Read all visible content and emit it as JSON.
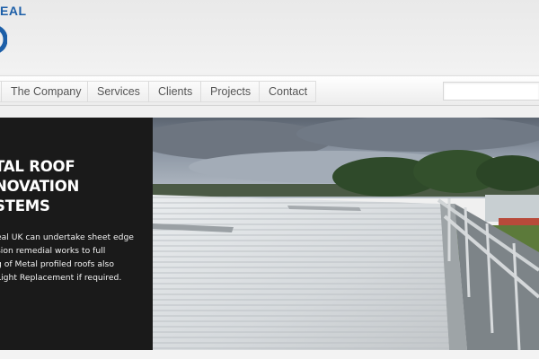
{
  "header": {
    "logo_text": "EAL",
    "logo_icon": "company-logo-mark"
  },
  "nav": {
    "items": [
      {
        "label": "The Company"
      },
      {
        "label": "Services"
      },
      {
        "label": "Clients"
      },
      {
        "label": "Projects"
      },
      {
        "label": "Contact"
      }
    ],
    "search_placeholder": ""
  },
  "hero": {
    "heading": "TAL ROOF\nNOVATION\nSTEMS",
    "body": "eal UK can undertake sheet edge\nsion remedial works to full\ng of Metal profiled roofs also\nLight Replacement if required.",
    "image_subject": "metal-profiled-roof-photo"
  },
  "slider": {
    "count": 3,
    "active_index": 0
  },
  "colors": {
    "brand_blue": "#1d5fa8",
    "nav_text": "#555555",
    "hero_panel": "#1a1a1a"
  }
}
